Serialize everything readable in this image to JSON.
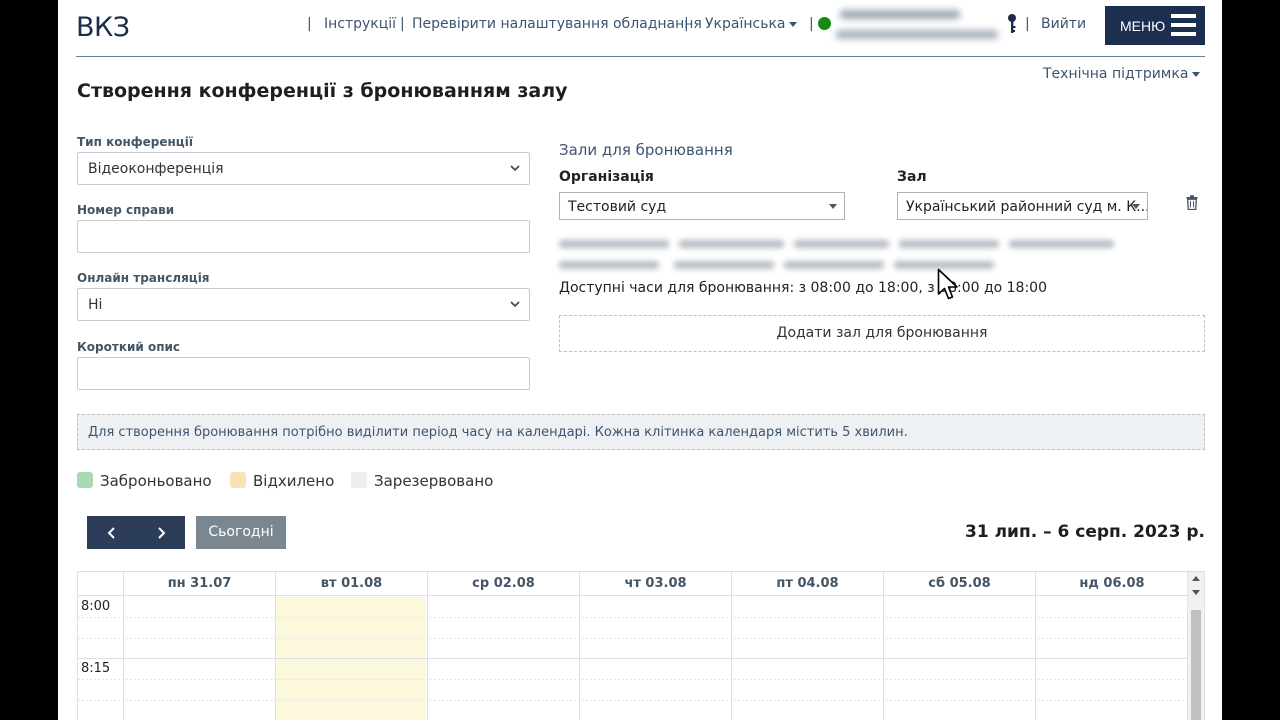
{
  "header": {
    "logo": "ВКЗ",
    "nav": {
      "instructions": "Інструкції",
      "check_equipment": "Перевірити налаштування обладнання",
      "language": "Українська",
      "logout": "Вийти",
      "menu": "МЕНЮ"
    },
    "separator": "|",
    "status_color": "#148a14"
  },
  "support": "Технічна підтримка",
  "page_title": "Створення конференції з бронюванням залу",
  "form": {
    "conference_type": {
      "label": "Тип конференції",
      "value": "Відеоконференція"
    },
    "case_number": {
      "label": "Номер справи",
      "value": ""
    },
    "online_stream": {
      "label": "Онлайн трансляція",
      "value": "Ні"
    },
    "short_description": {
      "label": "Короткий опис",
      "value": ""
    }
  },
  "halls": {
    "title": "Зали для бронювання",
    "organization_label": "Організація",
    "organization_value": "Тестовий суд",
    "hall_label": "Зал",
    "hall_value": "Український районний суд м. К...",
    "available_hours": "Доступні часи для бронювання: з 08:00 до 18:00, з 08:00 до 18:00",
    "add_hall": "Додати зал для бронювання"
  },
  "info_text": "Для створення бронювання потрібно виділити період часу на календарі. Кожна клітинка календаря містить 5 хвилин.",
  "legend": [
    {
      "label": "Заброньовано",
      "color": "#a8d9b0"
    },
    {
      "label": "Відхилено",
      "color": "#fbe0b5"
    },
    {
      "label": "Зарезервовано",
      "color": "#eeeeee"
    }
  ],
  "calendar": {
    "today": "Сьогодні",
    "range": "31 лип. – 6 серп. 2023 р.",
    "days": [
      "пн 31.07",
      "вт 01.08",
      "ср 02.08",
      "чт 03.08",
      "пт 04.08",
      "сб 05.08",
      "нд 06.08"
    ],
    "times": [
      "8:00",
      "8:15"
    ],
    "highlight_color": "#fcf8dc"
  }
}
